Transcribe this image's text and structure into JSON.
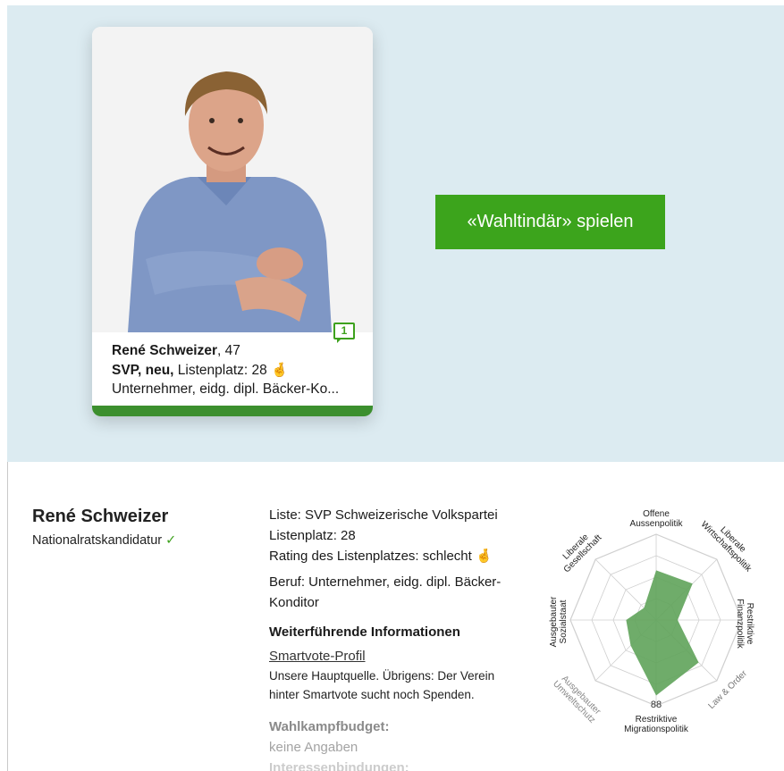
{
  "card": {
    "name_bold": "René Schweizer",
    "age": ", 47",
    "party_bold": "SVP, neu,",
    "list_label": " Listenplatz: 28",
    "hand_emoji": "🤞",
    "occupation": "Unternehmer, eidg. dipl. Bäcker-Ko...",
    "comment_count": "1"
  },
  "play_button": "«Wahltindär» spielen",
  "candidate": {
    "name": "René Schweizer",
    "candidacy": "Nationalratskandidatur",
    "check": "✓"
  },
  "details": {
    "liste": "Liste: SVP Schweizerische Volkspartei",
    "listenplatz": "Listenplatz: 28",
    "rating": "Rating des Listenplatzes: schlecht",
    "rating_emoji": "🤞",
    "beruf_line1": "Beruf: Unternehmer, eidg. dipl. Bäcker-",
    "beruf_line2": "Konditor",
    "further_heading": "Weiterführende Informationen",
    "smartvote_link": "Smartvote-Profil",
    "source_line1": "Unsere Hauptquelle. Übrigens: Der Verein",
    "source_line2": "hinter Smartvote sucht noch Spenden.",
    "budget_heading": "Wahlkampfbudget:",
    "budget_value": "keine Angaben",
    "interests_heading": "Interessenbindungen:"
  },
  "radar": {
    "labels": {
      "offene_1": "Offene",
      "offene_2": "Aussenpolitik",
      "lib_wirt_1": "Liberale",
      "lib_wirt_2": "Wirtschaftspolitik",
      "restr_fin_1": "Restriktive",
      "restr_fin_2": "Finanzpolitik",
      "law": "Law & Order",
      "restr_mig_1": "Restriktive",
      "restr_mig_2": "Migrationspolitik",
      "umwelt_1": "Ausgebauter",
      "umwelt_2": "Umweltschutz",
      "sozial_1": "Ausgebauter",
      "sozial_2": "Sozialstaat",
      "lib_ges_1": "Liberale",
      "lib_ges_2": "Gesellschaft"
    },
    "score_label": "88",
    "values": [
      0.58,
      0.6,
      0.25,
      0.7,
      0.88,
      0.42,
      0.35,
      0.2
    ],
    "fill_color": "#5fa35a"
  }
}
